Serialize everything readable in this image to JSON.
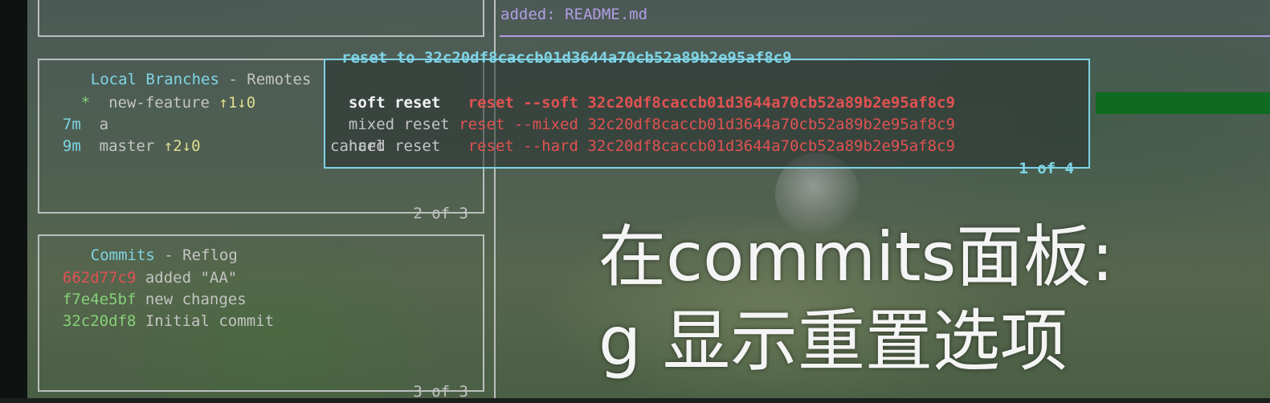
{
  "top_right": {
    "commit_message": "added: README.md"
  },
  "branches_panel": {
    "title_active": "Local Branches",
    "title_sep": " - ",
    "title_inactive": "Remotes",
    "footer": "2 of 3",
    "items": [
      {
        "time": "  *",
        "name": "new-feature",
        "status": "↑1↓0"
      },
      {
        "time": "7m",
        "name": "a",
        "status": ""
      },
      {
        "time": "9m",
        "name": "master",
        "status": "↑2↓0"
      }
    ]
  },
  "commits_panel": {
    "title_active": "Commits",
    "title_sep": " - ",
    "title_inactive": "Reflog",
    "footer": "3 of 3",
    "items": [
      {
        "hash": "662d77c9",
        "message": "added \"AA\""
      },
      {
        "hash": "f7e4e5bf",
        "message": "new changes"
      },
      {
        "hash": "32c20df8",
        "message": "Initial commit"
      }
    ]
  },
  "reset_menu": {
    "title": "reset to 32c20df8caccb01d3644a70cb52a89b2e95af8c9",
    "footer": "1 of 4",
    "options": [
      {
        "label": "soft reset ",
        "command": "reset --soft 32c20df8caccb01d3644a70cb52a89b2e95af8c9"
      },
      {
        "label": "mixed reset",
        "command": "reset --mixed 32c20df8caccb01d3644a70cb52a89b2e95af8c9"
      },
      {
        "label": "hard reset ",
        "command": "reset --hard 32c20df8caccb01d3644a70cb52a89b2e95af8c9"
      },
      {
        "label": "cancel",
        "command": ""
      }
    ]
  },
  "caption": {
    "line1": "在commits面板:",
    "line2": "g 显示重置选项"
  },
  "colors": {
    "panel_title_active": "#7fd4e6",
    "hash_red": "#e05252",
    "hash_green": "#88d07a",
    "status_yellow": "#dede8f",
    "diff_purple": "#b39de6"
  }
}
